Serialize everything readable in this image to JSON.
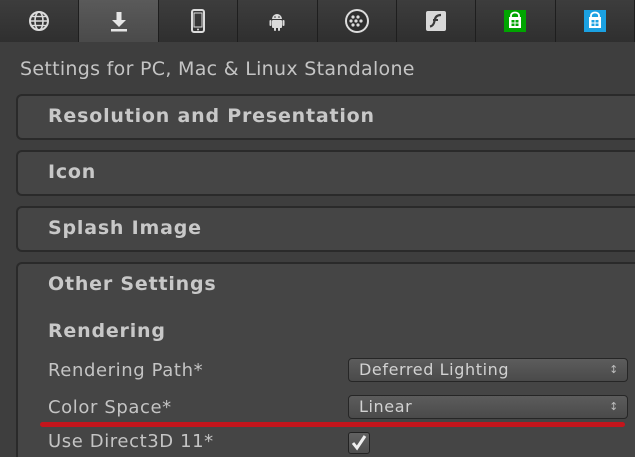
{
  "platform_tabs": [
    {
      "name": "web-player",
      "icon": "globe-icon",
      "active": false
    },
    {
      "name": "standalone",
      "icon": "download-icon",
      "active": true
    },
    {
      "name": "ios",
      "icon": "phone-icon",
      "active": false
    },
    {
      "name": "android",
      "icon": "android-icon",
      "active": false
    },
    {
      "name": "blackberry",
      "icon": "blackberry-icon",
      "active": false
    },
    {
      "name": "flash",
      "icon": "flash-icon",
      "active": false
    },
    {
      "name": "windows-store-green",
      "icon": "store-icon",
      "active": false
    },
    {
      "name": "windows-store-blue",
      "icon": "store-icon",
      "active": false
    }
  ],
  "header": {
    "title": "Settings for PC, Mac & Linux Standalone"
  },
  "sections": {
    "resolution": "Resolution and Presentation",
    "icon": "Icon",
    "splash": "Splash Image",
    "other": "Other Settings"
  },
  "other_settings": {
    "rendering_header": "Rendering",
    "rendering_path_label": "Rendering Path*",
    "rendering_path_value": "Deferred Lighting",
    "color_space_label": "Color Space*",
    "color_space_value": "Linear",
    "direct3d_label": "Use Direct3D 11*",
    "direct3d_checked": true
  },
  "colors": {
    "background": "#3e3e3e",
    "panel": "#454545",
    "text": "#c8c8c8",
    "highlight_underline": "#c4151c",
    "store_green": "#00a400",
    "store_blue": "#1ba1e2"
  }
}
